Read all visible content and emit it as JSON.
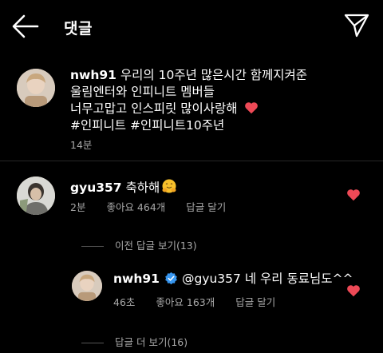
{
  "header": {
    "title": "댓글"
  },
  "caption": {
    "username": "nwh91",
    "line1": "우리의 10주년 많은시간 함께지켜준",
    "line2": "울림엔터와 인피니트 멤버들",
    "line3": "너무고맙고 인스피릿 많이사랑해",
    "line4": "#인피니트 #인피니트10주년",
    "time": "14분",
    "emoji": "heart-icon"
  },
  "comment": {
    "username": "gyu357",
    "text": "축하해",
    "emoji": "hugging-face-icon",
    "time": "2분",
    "likes": "좋아요 464개",
    "reply_label": "답글 달기",
    "liked": true
  },
  "view_previous": "이전 답글 보기(13)",
  "reply": {
    "username": "nwh91",
    "verified": true,
    "text": "@gyu357 네 우리 동료님도^^",
    "time": "46초",
    "likes": "좋아요 163개",
    "reply_label": "답글 달기",
    "liked": true
  },
  "view_more": "답글 더 보기(16)",
  "colors": {
    "heart": "#ed4956",
    "verified": "#3897f0",
    "meta": "#a8a8a8",
    "background": "#000000"
  }
}
